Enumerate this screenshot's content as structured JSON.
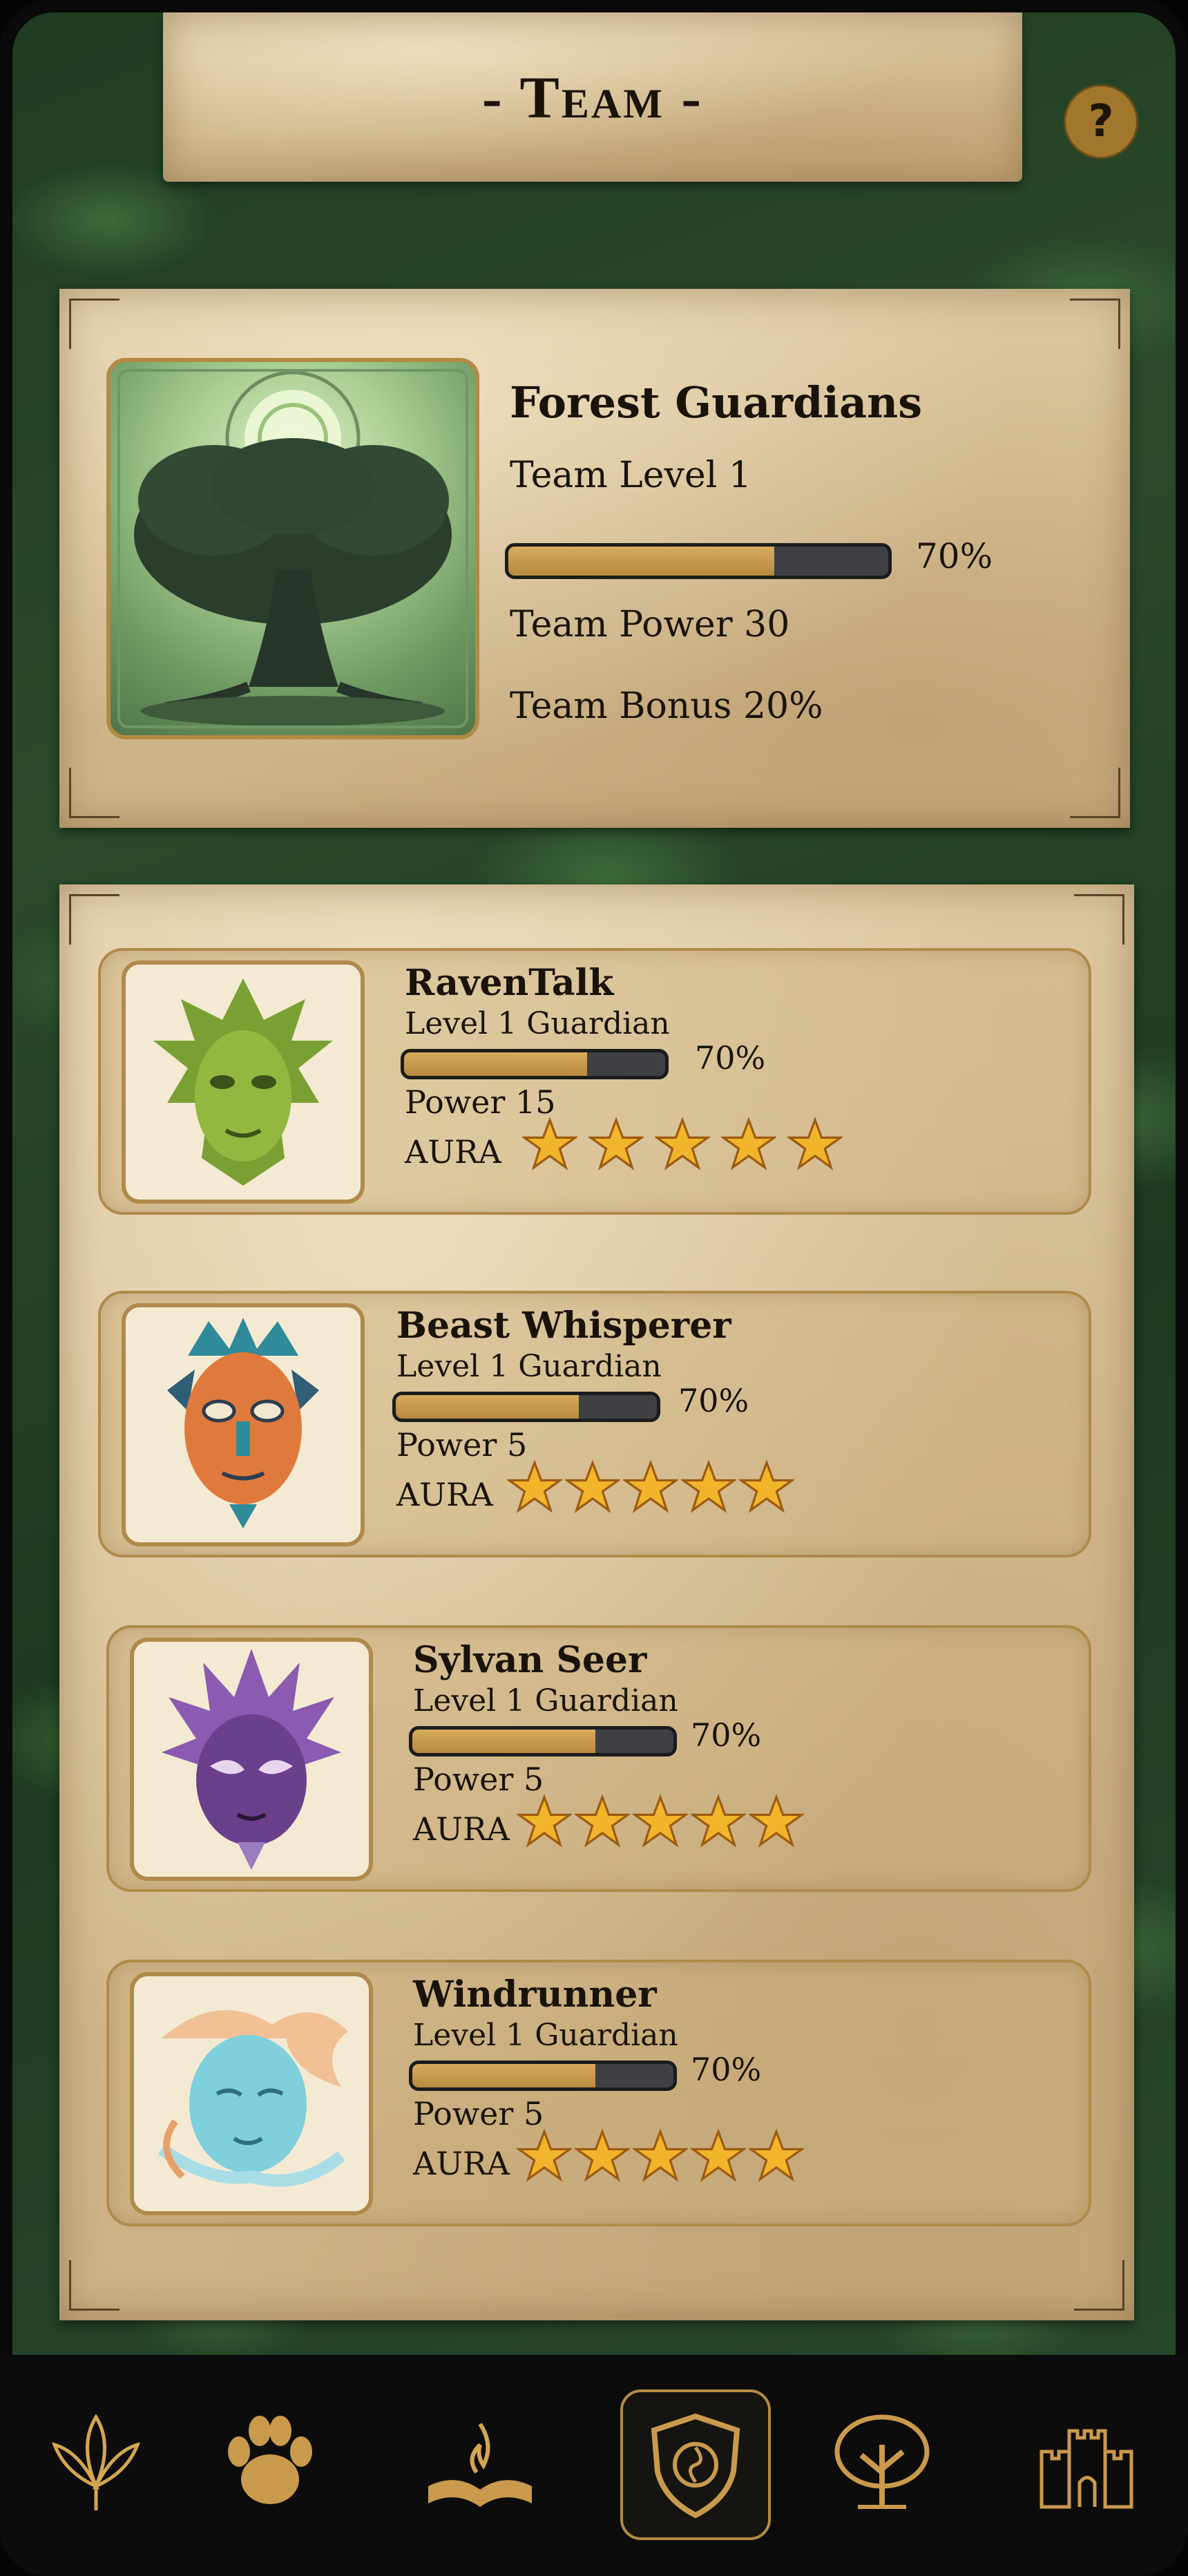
{
  "header": {
    "title": "- Team -",
    "help_label": "?"
  },
  "team": {
    "name": "Forest Guardians",
    "level_text": "Team Level 1",
    "progress": 0.7,
    "progress_label": "70%",
    "power_text": "Team Power 30",
    "bonus_text": "Team Bonus 20%"
  },
  "guardians": [
    {
      "name": "RavenTalk",
      "level_text": "Level 1 Guardian",
      "progress": 0.7,
      "progress_label": "70%",
      "power_text": "Power 15",
      "aura_label": "AURA",
      "stars": 5,
      "portrait": "green-leaf-mask"
    },
    {
      "name": "Beast Whisperer",
      "level_text": "Level 1 Guardian",
      "progress": 0.7,
      "progress_label": "70%",
      "power_text": "Power 5",
      "aura_label": "AURA",
      "stars": 5,
      "portrait": "orange-tribal-mask"
    },
    {
      "name": "Sylvan Seer",
      "level_text": "Level 1 Guardian",
      "progress": 0.7,
      "progress_label": "70%",
      "power_text": "Power 5",
      "aura_label": "AURA",
      "stars": 5,
      "portrait": "purple-feather-mask"
    },
    {
      "name": "Windrunner",
      "level_text": "Level 1 Guardian",
      "progress": 0.7,
      "progress_label": "70%",
      "power_text": "Power 5",
      "aura_label": "AURA",
      "stars": 5,
      "portrait": "blue-wind-face"
    }
  ],
  "nav": [
    {
      "icon": "lotus-icon",
      "active": false
    },
    {
      "icon": "paw-icon",
      "active": false
    },
    {
      "icon": "book-flame-icon",
      "active": false
    },
    {
      "icon": "shield-icon",
      "active": true
    },
    {
      "icon": "tree-icon",
      "active": false
    },
    {
      "icon": "castle-icon",
      "active": false
    }
  ],
  "colors": {
    "gold": "#b38b43",
    "bar_fill": "#c99c4f",
    "bar_track": "#3e4044",
    "text": "#1a130a",
    "nav_bg": "#0c0c0c"
  }
}
